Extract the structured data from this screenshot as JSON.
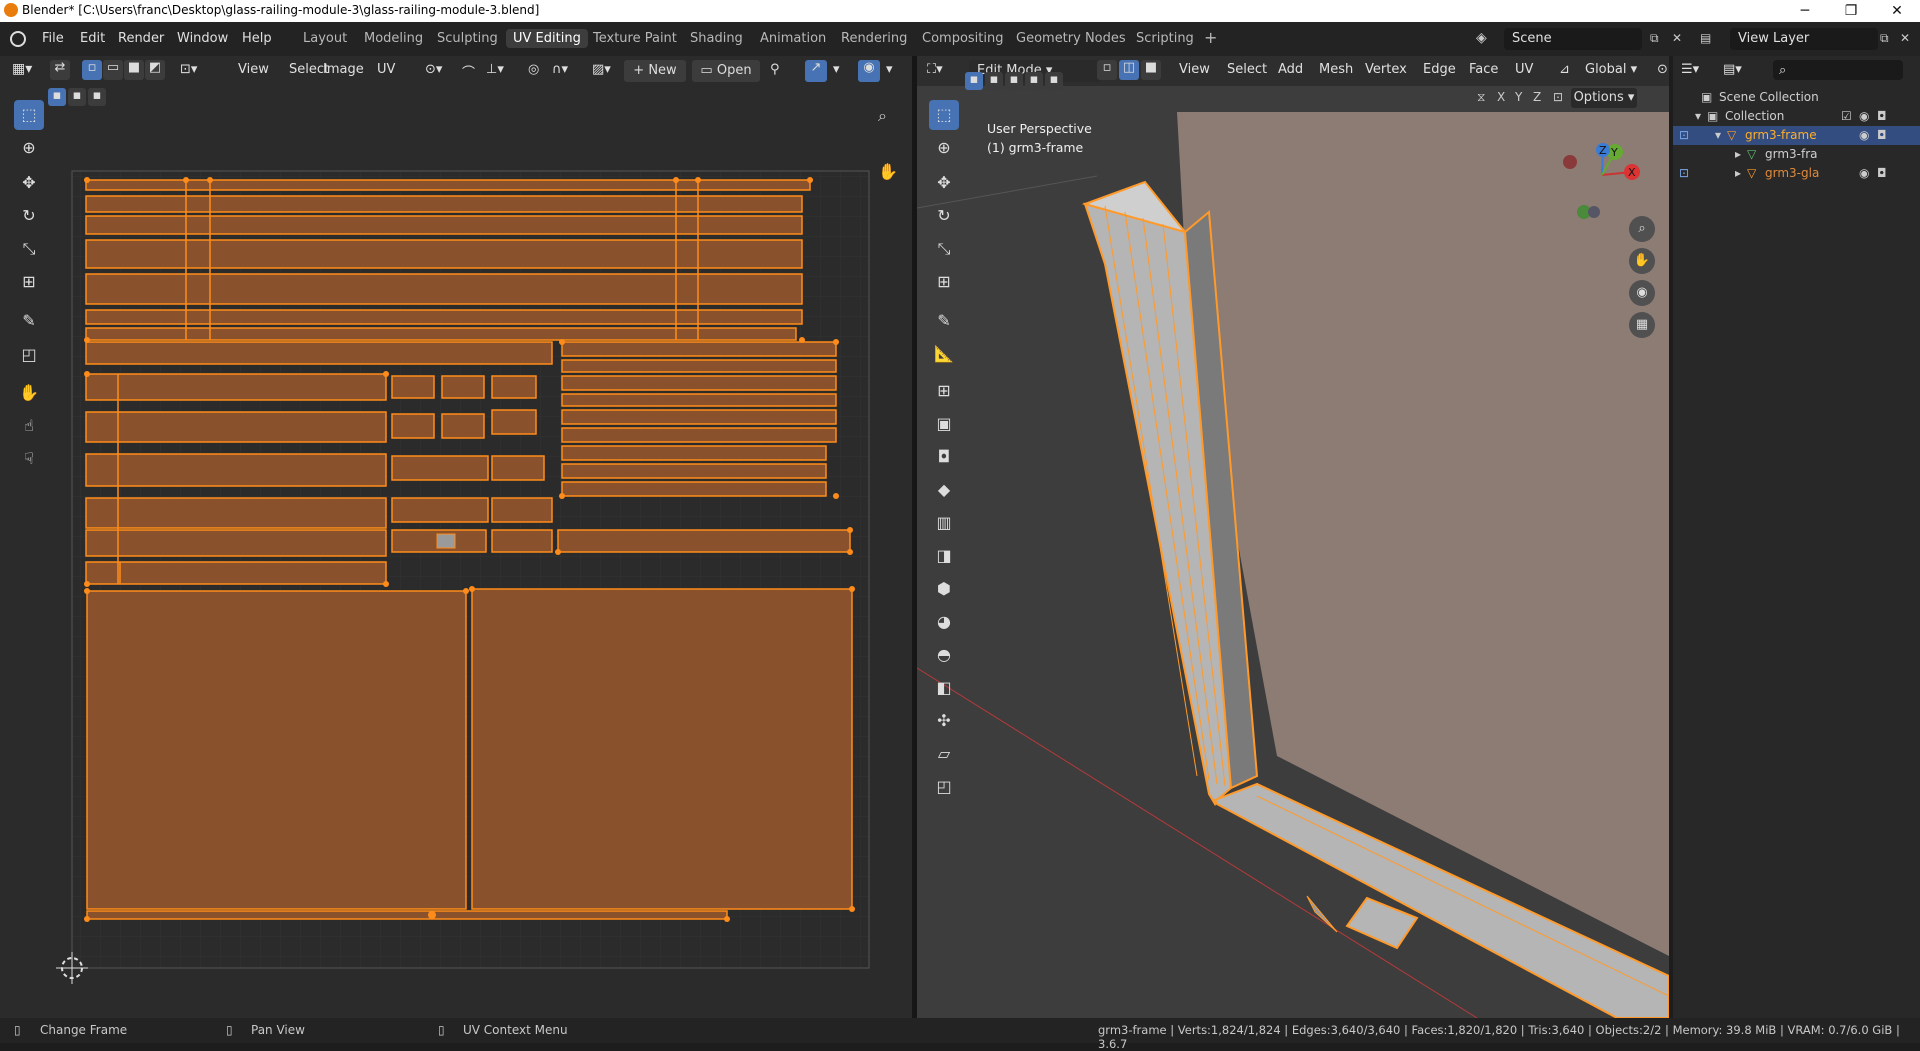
{
  "window": {
    "title": "Blender* [C:\\Users\\franc\\Desktop\\glass-railing-module-3\\glass-railing-module-3.blend]",
    "minimize": "─",
    "restore": "❐",
    "close": "✕"
  },
  "menu": [
    "File",
    "Edit",
    "Render",
    "Window",
    "Help"
  ],
  "workspaces": [
    "Layout",
    "Modeling",
    "Sculpting",
    "UV Editing",
    "Texture Paint",
    "Shading",
    "Animation",
    "Rendering",
    "Compositing",
    "Geometry Nodes",
    "Scripting"
  ],
  "active_workspace": "UV Editing",
  "add_workspace": "+",
  "scene": "Scene",
  "view_layer": "View Layer",
  "uv_editor": {
    "menus": [
      "View",
      "Select",
      "Image",
      "UV"
    ],
    "new_label": "New",
    "open_label": "Open"
  },
  "viewport": {
    "mode": "Edit Mode",
    "menus": [
      "View",
      "Select",
      "Add",
      "Mesh",
      "Vertex",
      "Edge",
      "Face",
      "UV"
    ],
    "transform_orientation": "Global",
    "axis_x": "X",
    "axis_y": "Y",
    "axis_z": "Z",
    "options": "Options",
    "perspective": "User Perspective",
    "object": "(1) grm3-frame",
    "gizmo_x": "X",
    "gizmo_y": "Y",
    "gizmo_z": "Z"
  },
  "outliner": {
    "scene_collection": "Scene Collection",
    "collection": "Collection",
    "items": [
      {
        "label": "grm3-frame",
        "selected": true
      },
      {
        "label": "grm3-fra",
        "selected": false
      },
      {
        "label": "grm3-gla",
        "selected": false
      }
    ]
  },
  "status": {
    "left": "Change Frame",
    "middle": "Pan View",
    "right": "UV Context Menu",
    "stats": "grm3-frame | Verts:1,824/1,824 | Edges:3,640/3,640 | Faces:1,820/1,820 | Tris:3,640 | Objects:2/2 | Memory: 39.8 MiB | VRAM: 0.7/6.0 GiB | 3.6.7"
  },
  "colors": {
    "accent": "#4772b3",
    "uv_face": "#8a522c",
    "uv_edge": "#ff8c1a",
    "selection": "#334d80"
  }
}
